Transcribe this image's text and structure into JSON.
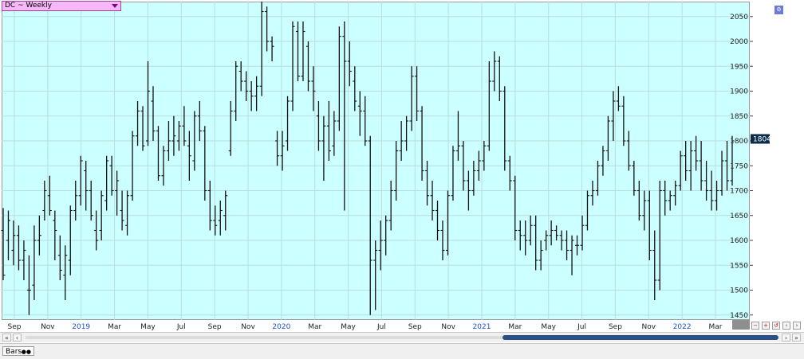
{
  "window": {
    "symbol_label": "DC ~ Weekly",
    "bottom_tab_label": "Bars"
  },
  "chart_data": {
    "type": "ohlc",
    "title": "DC ~ Weekly",
    "xlabel": "",
    "ylabel": "",
    "ylim": [
      1440,
      2080
    ],
    "yticks": [
      1450,
      1500,
      1550,
      1600,
      1650,
      1700,
      1750,
      1800,
      1850,
      1900,
      1950,
      2000,
      2050
    ],
    "x_tick_labels": [
      "Sep",
      "Nov",
      "2019",
      "Mar",
      "May",
      "Jul",
      "Sep",
      "Nov",
      "2020",
      "Mar",
      "May",
      "Jul",
      "Sep",
      "Nov",
      "2021",
      "Mar",
      "May",
      "Jul",
      "Sep",
      "Nov",
      "2022",
      "Mar"
    ],
    "year_labels": [
      "2019",
      "2020",
      "2021",
      "2022"
    ],
    "last_price": "1804",
    "grid": true,
    "series": [
      {
        "values": [
          [
            1620,
            1665,
            1520,
            1530
          ],
          [
            1600,
            1660,
            1560,
            1640
          ],
          [
            1580,
            1640,
            1550,
            1610
          ],
          [
            1610,
            1630,
            1540,
            1560
          ],
          [
            1560,
            1600,
            1520,
            1580
          ],
          [
            1500,
            1570,
            1450,
            1500
          ],
          [
            1510,
            1630,
            1480,
            1600
          ],
          [
            1600,
            1650,
            1570,
            1610
          ],
          [
            1660,
            1720,
            1640,
            1700
          ],
          [
            1690,
            1730,
            1650,
            1660
          ],
          [
            1640,
            1660,
            1560,
            1620
          ],
          [
            1570,
            1610,
            1520,
            1540
          ],
          [
            1530,
            1590,
            1480,
            1570
          ],
          [
            1560,
            1670,
            1530,
            1660
          ],
          [
            1660,
            1720,
            1640,
            1690
          ],
          [
            1690,
            1770,
            1670,
            1760
          ],
          [
            1740,
            1760,
            1660,
            1700
          ],
          [
            1700,
            1720,
            1640,
            1650
          ],
          [
            1620,
            1660,
            1580,
            1600
          ],
          [
            1620,
            1700,
            1600,
            1690
          ],
          [
            1680,
            1770,
            1660,
            1760
          ],
          [
            1750,
            1770,
            1690,
            1700
          ],
          [
            1700,
            1740,
            1650,
            1720
          ],
          [
            1660,
            1700,
            1620,
            1640
          ],
          [
            1630,
            1700,
            1610,
            1690
          ],
          [
            1690,
            1820,
            1680,
            1810
          ],
          [
            1810,
            1880,
            1790,
            1860
          ],
          [
            1860,
            1870,
            1780,
            1790
          ],
          [
            1800,
            1960,
            1790,
            1900
          ],
          [
            1880,
            1910,
            1800,
            1820
          ],
          [
            1820,
            1830,
            1720,
            1730
          ],
          [
            1730,
            1790,
            1710,
            1780
          ],
          [
            1780,
            1840,
            1760,
            1800
          ],
          [
            1800,
            1850,
            1770,
            1810
          ],
          [
            1800,
            1840,
            1780,
            1830
          ],
          [
            1830,
            1870,
            1790,
            1800
          ],
          [
            1790,
            1820,
            1720,
            1770
          ],
          [
            1760,
            1860,
            1740,
            1850
          ],
          [
            1850,
            1880,
            1800,
            1820
          ],
          [
            1820,
            1830,
            1680,
            1700
          ],
          [
            1700,
            1720,
            1620,
            1640
          ],
          [
            1640,
            1670,
            1610,
            1630
          ],
          [
            1640,
            1680,
            1610,
            1660
          ],
          [
            1650,
            1700,
            1620,
            1690
          ],
          [
            1780,
            1880,
            1770,
            1860
          ],
          [
            1860,
            1960,
            1840,
            1950
          ],
          [
            1940,
            1960,
            1900,
            1920
          ],
          [
            1920,
            1940,
            1880,
            1900
          ],
          [
            1900,
            1920,
            1860,
            1890
          ],
          [
            1890,
            1930,
            1860,
            1910
          ],
          [
            1910,
            2080,
            1890,
            2060
          ],
          [
            2060,
            2070,
            1980,
            2000
          ],
          [
            2000,
            2010,
            1960,
            1990
          ],
          [
            1800,
            1820,
            1750,
            1770
          ],
          [
            1770,
            1820,
            1740,
            1790
          ],
          [
            1800,
            1890,
            1780,
            1880
          ],
          [
            1880,
            2040,
            1860,
            2030
          ],
          [
            2020,
            2040,
            1920,
            1930
          ],
          [
            1930,
            2040,
            1920,
            2020
          ],
          [
            1990,
            2000,
            1900,
            1920
          ],
          [
            1920,
            1950,
            1860,
            1900
          ],
          [
            1850,
            1880,
            1780,
            1800
          ],
          [
            1800,
            1850,
            1720,
            1830
          ],
          [
            1830,
            1880,
            1760,
            1780
          ],
          [
            1790,
            1860,
            1770,
            1840
          ],
          [
            1840,
            2030,
            1820,
            2010
          ],
          [
            2010,
            2040,
            1660,
            1960
          ],
          [
            1960,
            2000,
            1910,
            1940
          ],
          [
            1920,
            1950,
            1860,
            1880
          ],
          [
            1870,
            1900,
            1810,
            1860
          ],
          [
            1860,
            1890,
            1790,
            1800
          ],
          [
            1800,
            1810,
            1450,
            1560
          ],
          [
            1560,
            1600,
            1460,
            1580
          ],
          [
            1580,
            1640,
            1540,
            1600
          ],
          [
            1600,
            1650,
            1570,
            1640
          ],
          [
            1640,
            1720,
            1620,
            1700
          ],
          [
            1700,
            1800,
            1680,
            1780
          ],
          [
            1780,
            1840,
            1760,
            1800
          ],
          [
            1800,
            1850,
            1780,
            1840
          ],
          [
            1840,
            1950,
            1820,
            1930
          ],
          [
            1930,
            1950,
            1840,
            1860
          ],
          [
            1860,
            1870,
            1720,
            1740
          ],
          [
            1740,
            1760,
            1670,
            1690
          ],
          [
            1690,
            1720,
            1640,
            1660
          ],
          [
            1660,
            1680,
            1600,
            1620
          ],
          [
            1620,
            1640,
            1560,
            1580
          ],
          [
            1580,
            1700,
            1570,
            1690
          ],
          [
            1690,
            1790,
            1680,
            1780
          ],
          [
            1780,
            1860,
            1760,
            1790
          ],
          [
            1790,
            1800,
            1700,
            1720
          ],
          [
            1720,
            1740,
            1660,
            1700
          ],
          [
            1700,
            1760,
            1690,
            1740
          ],
          [
            1740,
            1780,
            1720,
            1760
          ],
          [
            1760,
            1800,
            1740,
            1790
          ],
          [
            1790,
            1960,
            1780,
            1920
          ],
          [
            1920,
            1980,
            1900,
            1960
          ],
          [
            1960,
            1970,
            1880,
            1900
          ],
          [
            1900,
            1910,
            1740,
            1760
          ],
          [
            1760,
            1770,
            1700,
            1720
          ],
          [
            1720,
            1730,
            1600,
            1620
          ],
          [
            1620,
            1640,
            1580,
            1610
          ],
          [
            1610,
            1640,
            1570,
            1600
          ],
          [
            1600,
            1650,
            1590,
            1630
          ],
          [
            1630,
            1650,
            1540,
            1560
          ],
          [
            1560,
            1600,
            1540,
            1580
          ],
          [
            1600,
            1620,
            1580,
            1610
          ],
          [
            1610,
            1640,
            1590,
            1620
          ],
          [
            1620,
            1630,
            1600,
            1610
          ],
          [
            1610,
            1620,
            1580,
            1600
          ],
          [
            1600,
            1620,
            1560,
            1580
          ],
          [
            1580,
            1610,
            1530,
            1600
          ],
          [
            1590,
            1610,
            1570,
            1590
          ],
          [
            1590,
            1650,
            1580,
            1630
          ],
          [
            1630,
            1700,
            1620,
            1690
          ],
          [
            1690,
            1720,
            1670,
            1700
          ],
          [
            1700,
            1760,
            1690,
            1750
          ],
          [
            1750,
            1790,
            1730,
            1780
          ],
          [
            1780,
            1850,
            1760,
            1840
          ],
          [
            1840,
            1900,
            1800,
            1880
          ],
          [
            1880,
            1910,
            1860,
            1870
          ],
          [
            1870,
            1890,
            1790,
            1800
          ],
          [
            1800,
            1820,
            1740,
            1750
          ],
          [
            1750,
            1760,
            1690,
            1700
          ],
          [
            1700,
            1720,
            1640,
            1650
          ],
          [
            1650,
            1700,
            1620,
            1680
          ],
          [
            1680,
            1700,
            1560,
            1580
          ],
          [
            1580,
            1620,
            1480,
            1520
          ],
          [
            1520,
            1720,
            1500,
            1700
          ],
          [
            1700,
            1720,
            1650,
            1680
          ],
          [
            1680,
            1700,
            1660,
            1690
          ],
          [
            1690,
            1720,
            1670,
            1710
          ],
          [
            1710,
            1780,
            1700,
            1770
          ],
          [
            1770,
            1800,
            1720,
            1740
          ],
          [
            1740,
            1800,
            1700,
            1780
          ],
          [
            1780,
            1810,
            1740,
            1760
          ],
          [
            1760,
            1800,
            1700,
            1720
          ],
          [
            1720,
            1760,
            1680,
            1700
          ],
          [
            1700,
            1740,
            1660,
            1680
          ],
          [
            1680,
            1720,
            1660,
            1700
          ],
          [
            1700,
            1780,
            1690,
            1760
          ],
          [
            1760,
            1800,
            1700,
            1720
          ],
          [
            1720,
            1810,
            1710,
            1800
          ]
        ]
      }
    ]
  }
}
